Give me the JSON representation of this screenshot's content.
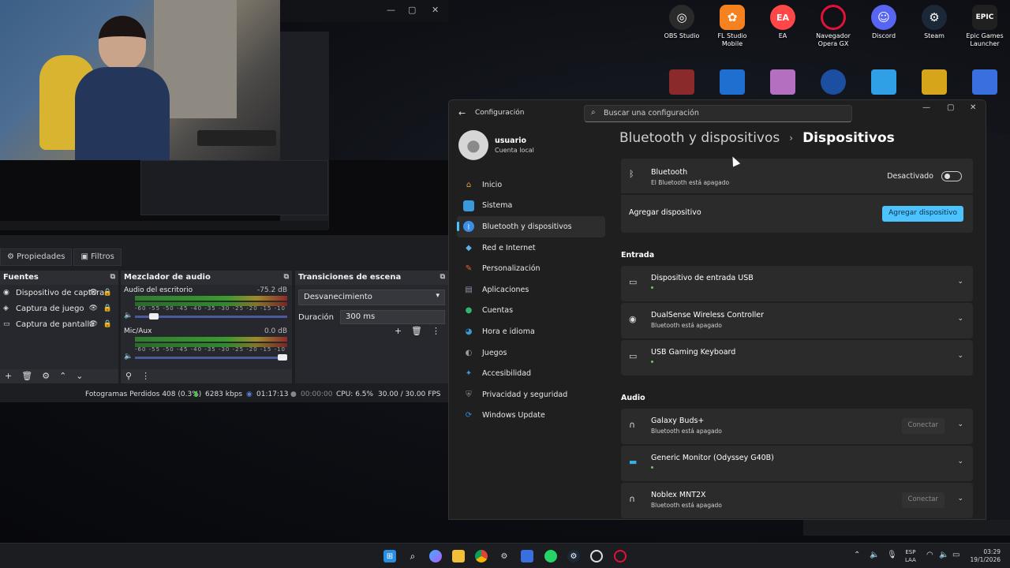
{
  "desktop_icons": [
    {
      "label": "OBS Studio",
      "icon": "obs-icon",
      "color": "#2a2a2a"
    },
    {
      "label": "FL Studio Mobile",
      "icon": "fl-studio-icon",
      "color": "#f5821f"
    },
    {
      "label": "EA",
      "icon": "ea-icon",
      "color": "#ff4747"
    },
    {
      "label": "Navegador Opera GX",
      "icon": "opera-gx-icon",
      "color": "#e0123a"
    },
    {
      "label": "Discord",
      "icon": "discord-icon",
      "color": "#5865f2"
    },
    {
      "label": "Steam",
      "icon": "steam-icon",
      "color": "#1b2838"
    },
    {
      "label": "Epic Games Launcher",
      "icon": "epic-games-icon",
      "color": "#202020"
    }
  ],
  "obs": {
    "tabs": [
      "Propiedades",
      "Filtros"
    ],
    "sources": {
      "title": "Fuentes",
      "items": [
        "Dispositivo de captura",
        "Captura de juego",
        "Captura de pantalla"
      ]
    },
    "mixer": {
      "title": "Mezclador de audio",
      "channels": [
        {
          "name": "Audio del escritorio",
          "db": "-75.2 dB",
          "volume": 0.1
        },
        {
          "name": "Mic/Aux",
          "db": "0.0 dB",
          "volume": 1.0
        }
      ],
      "ticks": "-60 -55 -50 -45 -40 -35 -30 -25 -20 -15 -10 -5 0"
    },
    "transitions": {
      "title": "Transiciones de escena",
      "selected": "Desvanecimiento",
      "duration_label": "Duración",
      "duration_value": "300 ms"
    },
    "status": {
      "dropped": "Fotogramas Perdidos 408 (0.3%)",
      "bitrate": "6283 kbps",
      "stream_time": "01:17:13",
      "rec_time": "00:00:00",
      "cpu": "CPU: 6.5%",
      "fps": "30.00 / 30.00 FPS"
    }
  },
  "settings": {
    "app_title": "Configuración",
    "search_placeholder": "Buscar una configuración",
    "user": {
      "name": "usuario",
      "sub": "Cuenta local"
    },
    "nav": [
      {
        "label": "Inicio",
        "icon": "home-icon",
        "color": "#e8a23a"
      },
      {
        "label": "Sistema",
        "icon": "system-icon",
        "color": "#3a9ad9"
      },
      {
        "label": "Bluetooth y dispositivos",
        "icon": "bluetooth-icon",
        "color": "#3a8ee6"
      },
      {
        "label": "Red e Internet",
        "icon": "network-icon",
        "color": "#5ab0e8"
      },
      {
        "label": "Personalización",
        "icon": "brush-icon",
        "color": "#e0663a"
      },
      {
        "label": "Aplicaciones",
        "icon": "apps-icon",
        "color": "#8a95a8"
      },
      {
        "label": "Cuentas",
        "icon": "accounts-icon",
        "color": "#2fb86a"
      },
      {
        "label": "Hora e idioma",
        "icon": "time-language-icon",
        "color": "#3a9ad9"
      },
      {
        "label": "Juegos",
        "icon": "gaming-icon",
        "color": "#9a9a9a"
      },
      {
        "label": "Accesibilidad",
        "icon": "accessibility-icon",
        "color": "#3a9ad9"
      },
      {
        "label": "Privacidad y seguridad",
        "icon": "shield-icon",
        "color": "#8a8a8a"
      },
      {
        "label": "Windows Update",
        "icon": "update-icon",
        "color": "#2a8ee0"
      }
    ],
    "breadcrumb": [
      "Bluetooth y dispositivos",
      "Dispositivos"
    ],
    "bluetooth": {
      "title": "Bluetooth",
      "sub": "El Bluetooth está apagado",
      "state": "Desactivado"
    },
    "add_device": {
      "label": "Agregar dispositivo",
      "button": "Agregar dispositivo"
    },
    "sections": {
      "input": "Entrada",
      "audio": "Audio"
    },
    "input_devices": [
      {
        "name": "Dispositivo de entrada USB",
        "sub": "",
        "icon": "keyboard-icon"
      },
      {
        "name": "DualSense Wireless Controller",
        "sub": "Bluetooth está apagado",
        "icon": "gamepad-icon"
      },
      {
        "name": "USB Gaming Keyboard",
        "sub": "",
        "icon": "keyboard-icon"
      }
    ],
    "audio_devices": [
      {
        "name": "Galaxy  Buds+",
        "sub": "Bluetooth está apagado",
        "icon": "headphones-icon",
        "button": "Conectar"
      },
      {
        "name": "Generic Monitor (Odyssey G40B)",
        "sub": "",
        "icon": "monitor-icon",
        "button": ""
      },
      {
        "name": "Noblex MNT2X",
        "sub": "Bluetooth está apagado",
        "icon": "headphones-icon",
        "button": "Conectar"
      }
    ]
  },
  "taskbar": {
    "lang": [
      "ESP",
      "LAA"
    ],
    "time": "03:29",
    "date": "19/1/2026"
  }
}
